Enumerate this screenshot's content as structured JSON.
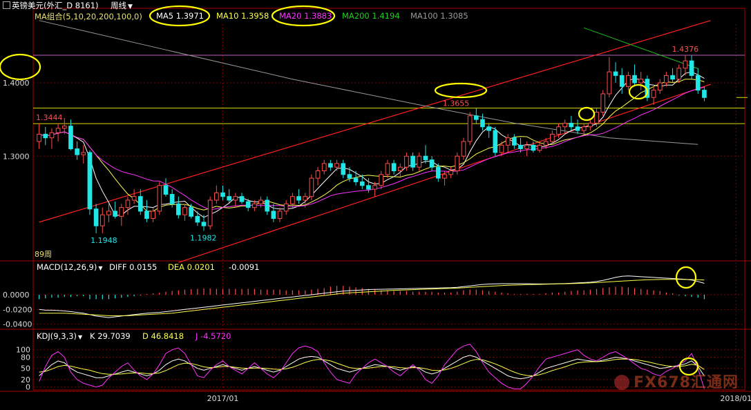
{
  "app": {
    "symbol_title": "英镑美元(外汇_D 8161)",
    "period_label": "周线",
    "period_icon": "chevron-down-icon",
    "watermark_text": "FX678汇通网"
  },
  "colors": {
    "background": "#000000",
    "up_candle": "#ff4d4d",
    "down_candle": "#20e6e6",
    "ma5": "#ffffff",
    "ma10": "#ffff4d",
    "ma20": "#ff33ff",
    "ma200": "#20c020",
    "ma100": "#9a9a9a",
    "channel": "#ff2020",
    "level_lines": "#e0e000",
    "highlight_ellipse": "#ffff00",
    "grid": "#800000"
  },
  "main_header": {
    "ma_group": "MA组合(5,10,20,200,100,0)",
    "ma5": "MA5 1.3971",
    "ma10": "MA10 1.3958",
    "ma20": "MA20 1.3883",
    "ma200": "MA200 1.4194",
    "ma100": "MA100 1.3085"
  },
  "macd_header": {
    "name": "MACD(12,26,9)",
    "diff": "DIFF 0.0155",
    "dea": "DEA 0.0201",
    "macd": "-0.0091"
  },
  "kdj_header": {
    "name": "KDJ(9,3,3)",
    "k": "K 29.7039",
    "d": "D 46.8418",
    "j": "J -4.5720"
  },
  "price_axis": {
    "ticks": [
      {
        "value": 1.4,
        "label": "1.4000"
      },
      {
        "value": 1.3,
        "label": "1.3000"
      }
    ]
  },
  "macd_axis": {
    "ticks": [
      {
        "value": 0.0,
        "label": "0.0000"
      },
      {
        "value": -0.02,
        "label": "-0.0200"
      },
      {
        "value": -0.04,
        "label": "-0.0400"
      }
    ]
  },
  "kdj_axis": {
    "ticks": [
      {
        "value": 100,
        "label": "100"
      },
      {
        "value": 80,
        "label": "80"
      },
      {
        "value": 50,
        "label": "50"
      },
      {
        "value": 20,
        "label": "20"
      },
      {
        "value": 0,
        "label": "0"
      }
    ]
  },
  "time_axis": {
    "labels": [
      {
        "bar": 29,
        "label": "2017/01"
      },
      {
        "bar": 110,
        "label": "2018/01"
      }
    ]
  },
  "annotations": {
    "high_label": "1.4376",
    "mid_high_label": "1.3655",
    "level_label": "1.3444",
    "low1_label": "1.1948",
    "low2_label": "1.1982",
    "weeks_label": "89周"
  },
  "chart_data": {
    "type": "candlestick",
    "instrument": "英镑美元(外汇_D 8161)",
    "period": "周线",
    "ylim": [
      1.16,
      1.48
    ],
    "ohlc": [
      [
        1.32,
        1.345,
        1.31,
        1.33
      ],
      [
        1.33,
        1.34,
        1.315,
        1.325
      ],
      [
        1.325,
        1.338,
        1.31,
        1.332
      ],
      [
        1.332,
        1.345,
        1.32,
        1.338
      ],
      [
        1.338,
        1.352,
        1.33,
        1.341
      ],
      [
        1.341,
        1.35,
        1.308,
        1.31
      ],
      [
        1.31,
        1.32,
        1.295,
        1.302
      ],
      [
        1.302,
        1.315,
        1.29,
        1.305
      ],
      [
        1.305,
        1.308,
        1.22,
        1.228
      ],
      [
        1.228,
        1.235,
        1.1948,
        1.205
      ],
      [
        1.205,
        1.23,
        1.195,
        1.22
      ],
      [
        1.22,
        1.235,
        1.21,
        1.225
      ],
      [
        1.225,
        1.238,
        1.215,
        1.218
      ],
      [
        1.218,
        1.235,
        1.205,
        1.23
      ],
      [
        1.23,
        1.245,
        1.22,
        1.24
      ],
      [
        1.24,
        1.255,
        1.235,
        1.245
      ],
      [
        1.245,
        1.255,
        1.22,
        1.225
      ],
      [
        1.225,
        1.24,
        1.21,
        1.215
      ],
      [
        1.215,
        1.23,
        1.21,
        1.225
      ],
      [
        1.225,
        1.265,
        1.22,
        1.26
      ],
      [
        1.26,
        1.27,
        1.245,
        1.248
      ],
      [
        1.248,
        1.255,
        1.23,
        1.235
      ],
      [
        1.235,
        1.245,
        1.215,
        1.22
      ],
      [
        1.22,
        1.235,
        1.212,
        1.23
      ],
      [
        1.23,
        1.235,
        1.215,
        1.218
      ],
      [
        1.218,
        1.225,
        1.205,
        1.21
      ],
      [
        1.21,
        1.22,
        1.1982,
        1.205
      ],
      [
        1.205,
        1.245,
        1.2,
        1.24
      ],
      [
        1.24,
        1.26,
        1.235,
        1.25
      ],
      [
        1.25,
        1.26,
        1.24,
        1.245
      ],
      [
        1.245,
        1.255,
        1.235,
        1.24
      ],
      [
        1.24,
        1.25,
        1.23,
        1.245
      ],
      [
        1.245,
        1.25,
        1.235,
        1.238
      ],
      [
        1.238,
        1.242,
        1.225,
        1.23
      ],
      [
        1.23,
        1.24,
        1.225,
        1.235
      ],
      [
        1.235,
        1.245,
        1.23,
        1.24
      ],
      [
        1.24,
        1.245,
        1.22,
        1.225
      ],
      [
        1.225,
        1.235,
        1.21,
        1.215
      ],
      [
        1.215,
        1.23,
        1.21,
        1.225
      ],
      [
        1.225,
        1.24,
        1.22,
        1.235
      ],
      [
        1.235,
        1.25,
        1.23,
        1.245
      ],
      [
        1.245,
        1.255,
        1.235,
        1.24
      ],
      [
        1.24,
        1.25,
        1.23,
        1.245
      ],
      [
        1.245,
        1.275,
        1.24,
        1.27
      ],
      [
        1.27,
        1.285,
        1.26,
        1.28
      ],
      [
        1.28,
        1.295,
        1.275,
        1.29
      ],
      [
        1.29,
        1.295,
        1.28,
        1.285
      ],
      [
        1.285,
        1.295,
        1.28,
        1.29
      ],
      [
        1.29,
        1.295,
        1.27,
        1.275
      ],
      [
        1.275,
        1.285,
        1.265,
        1.27
      ],
      [
        1.27,
        1.28,
        1.26,
        1.265
      ],
      [
        1.265,
        1.275,
        1.255,
        1.26
      ],
      [
        1.26,
        1.27,
        1.25,
        1.255
      ],
      [
        1.255,
        1.265,
        1.245,
        1.26
      ],
      [
        1.26,
        1.28,
        1.255,
        1.275
      ],
      [
        1.275,
        1.295,
        1.27,
        1.29
      ],
      [
        1.29,
        1.295,
        1.275,
        1.28
      ],
      [
        1.28,
        1.29,
        1.27,
        1.285
      ],
      [
        1.285,
        1.305,
        1.28,
        1.3
      ],
      [
        1.3,
        1.305,
        1.28,
        1.285
      ],
      [
        1.285,
        1.305,
        1.28,
        1.3
      ],
      [
        1.3,
        1.315,
        1.29,
        1.295
      ],
      [
        1.295,
        1.3,
        1.28,
        1.285
      ],
      [
        1.285,
        1.29,
        1.265,
        1.27
      ],
      [
        1.27,
        1.28,
        1.26,
        1.275
      ],
      [
        1.275,
        1.285,
        1.27,
        1.28
      ],
      [
        1.28,
        1.305,
        1.275,
        1.3
      ],
      [
        1.3,
        1.325,
        1.295,
        1.32
      ],
      [
        1.32,
        1.36,
        1.315,
        1.355
      ],
      [
        1.355,
        1.3655,
        1.345,
        1.35
      ],
      [
        1.35,
        1.358,
        1.335,
        1.34
      ],
      [
        1.34,
        1.345,
        1.325,
        1.335
      ],
      [
        1.335,
        1.34,
        1.3,
        1.305
      ],
      [
        1.305,
        1.32,
        1.3,
        1.315
      ],
      [
        1.315,
        1.33,
        1.305,
        1.325
      ],
      [
        1.325,
        1.33,
        1.31,
        1.315
      ],
      [
        1.315,
        1.325,
        1.305,
        1.31
      ],
      [
        1.31,
        1.32,
        1.3,
        1.315
      ],
      [
        1.315,
        1.32,
        1.305,
        1.308
      ],
      [
        1.308,
        1.32,
        1.305,
        1.315
      ],
      [
        1.315,
        1.325,
        1.31,
        1.32
      ],
      [
        1.32,
        1.335,
        1.315,
        1.33
      ],
      [
        1.33,
        1.345,
        1.325,
        1.34
      ],
      [
        1.34,
        1.35,
        1.33,
        1.345
      ],
      [
        1.345,
        1.355,
        1.335,
        1.34
      ],
      [
        1.34,
        1.35,
        1.33,
        1.335
      ],
      [
        1.335,
        1.345,
        1.33,
        1.34
      ],
      [
        1.34,
        1.35,
        1.335,
        1.345
      ],
      [
        1.345,
        1.365,
        1.34,
        1.36
      ],
      [
        1.36,
        1.39,
        1.355,
        1.385
      ],
      [
        1.385,
        1.435,
        1.38,
        1.415
      ],
      [
        1.415,
        1.428,
        1.4,
        1.41
      ],
      [
        1.41,
        1.42,
        1.385,
        1.395
      ],
      [
        1.395,
        1.415,
        1.39,
        1.41
      ],
      [
        1.41,
        1.425,
        1.395,
        1.4
      ],
      [
        1.4,
        1.415,
        1.39,
        1.405
      ],
      [
        1.405,
        1.41,
        1.375,
        1.38
      ],
      [
        1.38,
        1.395,
        1.37,
        1.39
      ],
      [
        1.39,
        1.405,
        1.385,
        1.4
      ],
      [
        1.4,
        1.415,
        1.395,
        1.41
      ],
      [
        1.41,
        1.42,
        1.4,
        1.405
      ],
      [
        1.405,
        1.425,
        1.4,
        1.42
      ],
      [
        1.42,
        1.4376,
        1.41,
        1.43
      ],
      [
        1.43,
        1.4376,
        1.405,
        1.41
      ],
      [
        1.41,
        1.42,
        1.385,
        1.39
      ],
      [
        1.39,
        1.395,
        1.375,
        1.38
      ]
    ],
    "ma5_label": "MA5 1.3971",
    "ma10_label": "MA10 1.3958",
    "ma20_label": "MA20 1.3883",
    "ma200_label": "MA200 1.4194",
    "ma100_label": "MA100 1.3085",
    "ma100_line": [
      [
        0,
        1.485
      ],
      [
        20,
        1.445
      ],
      [
        40,
        1.405
      ],
      [
        60,
        1.37
      ],
      [
        75,
        1.345
      ],
      [
        90,
        1.325
      ],
      [
        104,
        1.316
      ]
    ],
    "ma200_line": [
      [
        86,
        1.475
      ],
      [
        104,
        1.4194
      ]
    ],
    "channel_upper": [
      [
        0,
        1.21
      ],
      [
        106,
        1.485
      ]
    ],
    "channel_lower": [
      [
        22,
        1.155
      ],
      [
        106,
        1.398
      ]
    ],
    "horizontal_levels": [
      1.4376,
      1.3655,
      1.3444
    ],
    "macd": {
      "hist": [
        -0.006,
        -0.005,
        -0.004,
        -0.004,
        -0.003,
        -0.003,
        -0.002,
        -0.002,
        -0.006,
        -0.006,
        -0.006,
        -0.006,
        -0.005,
        -0.004,
        -0.003,
        -0.002,
        -0.001,
        0.001,
        0.002,
        0.003,
        0.004,
        0.005,
        0.006,
        0.007,
        0.0075,
        0.008,
        0.0085,
        0.0085,
        0.008,
        0.008,
        0.008,
        0.008,
        0.008,
        0.008,
        0.008,
        0.007,
        0.007,
        0.007,
        0.007,
        0.006,
        0.006,
        0.006,
        0.006,
        0.007,
        0.008,
        0.009,
        0.011,
        0.012,
        0.012,
        0.011,
        0.01,
        0.009,
        0.008,
        0.007,
        0.006,
        0.006,
        0.005,
        0.005,
        0.005,
        0.004,
        0.004,
        0.004,
        0.004,
        0.003,
        0.003,
        0.003,
        0.004,
        0.006,
        0.007,
        0.007,
        0.006,
        0.005,
        0.004,
        0.003,
        0.002,
        0.001,
        0.001,
        0.001,
        0.001,
        0.001,
        0.002,
        0.003,
        0.003,
        0.004,
        0.005,
        0.006,
        0.006,
        0.007,
        0.008,
        0.009,
        0.01,
        0.011,
        0.011,
        0.01,
        0.009,
        0.008,
        0.007,
        0.006,
        0.005,
        0.003,
        0.002,
        -0.001,
        -0.002,
        -0.003,
        -0.004,
        -0.006
      ],
      "diff": [
        -0.02,
        -0.021,
        -0.021,
        -0.0215,
        -0.022,
        -0.023,
        -0.024,
        -0.025,
        -0.027,
        -0.029,
        -0.03,
        -0.031,
        -0.03,
        -0.029,
        -0.028,
        -0.027,
        -0.026,
        -0.025,
        -0.0245,
        -0.024,
        -0.023,
        -0.022,
        -0.021,
        -0.02,
        -0.019,
        -0.018,
        -0.017,
        -0.016,
        -0.015,
        -0.014,
        -0.013,
        -0.012,
        -0.011,
        -0.01,
        -0.009,
        -0.008,
        -0.007,
        -0.006,
        -0.005,
        -0.004,
        -0.003,
        -0.002,
        -0.001,
        0.0,
        0.001,
        0.002,
        0.003,
        0.004,
        0.005,
        0.0055,
        0.006,
        0.0065,
        0.007,
        0.0072,
        0.0074,
        0.0076,
        0.0078,
        0.008,
        0.0082,
        0.0084,
        0.0086,
        0.0088,
        0.009,
        0.0092,
        0.0094,
        0.0096,
        0.01,
        0.011,
        0.012,
        0.013,
        0.014,
        0.0145,
        0.0148,
        0.015,
        0.015,
        0.015,
        0.015,
        0.015,
        0.0148,
        0.0146,
        0.0146,
        0.0148,
        0.015,
        0.0152,
        0.0156,
        0.016,
        0.0165,
        0.017,
        0.018,
        0.0195,
        0.0215,
        0.0235,
        0.025,
        0.0255,
        0.025,
        0.0245,
        0.024,
        0.0235,
        0.023,
        0.0225,
        0.022,
        0.0215,
        0.021,
        0.02,
        0.018,
        0.0155
      ],
      "dea": [
        -0.025,
        -0.025,
        -0.025,
        -0.025,
        -0.025,
        -0.0255,
        -0.026,
        -0.0265,
        -0.027,
        -0.0275,
        -0.028,
        -0.0285,
        -0.0285,
        -0.0285,
        -0.0285,
        -0.028,
        -0.0275,
        -0.027,
        -0.0265,
        -0.026,
        -0.0255,
        -0.025,
        -0.024,
        -0.023,
        -0.022,
        -0.021,
        -0.02,
        -0.019,
        -0.018,
        -0.017,
        -0.016,
        -0.015,
        -0.014,
        -0.013,
        -0.012,
        -0.011,
        -0.01,
        -0.009,
        -0.008,
        -0.007,
        -0.006,
        -0.005,
        -0.004,
        -0.003,
        -0.002,
        -0.001,
        0.0,
        0.001,
        0.002,
        0.0025,
        0.003,
        0.0035,
        0.004,
        0.0045,
        0.005,
        0.0055,
        0.006,
        0.0063,
        0.0066,
        0.0069,
        0.0072,
        0.0075,
        0.0078,
        0.0081,
        0.0084,
        0.0087,
        0.009,
        0.0095,
        0.01,
        0.0105,
        0.011,
        0.0115,
        0.012,
        0.0125,
        0.0128,
        0.0131,
        0.0134,
        0.0137,
        0.0139,
        0.0141,
        0.0143,
        0.0145,
        0.0147,
        0.0149,
        0.0151,
        0.0154,
        0.0157,
        0.016,
        0.0165,
        0.017,
        0.0175,
        0.018,
        0.0185,
        0.019,
        0.0195,
        0.02,
        0.0203,
        0.0205,
        0.0207,
        0.0208,
        0.0208,
        0.0208,
        0.0207,
        0.0206,
        0.0204,
        0.0201
      ]
    },
    "kdj": {
      "k": [
        30,
        45,
        60,
        70,
        65,
        50,
        40,
        35,
        30,
        25,
        25,
        30,
        35,
        40,
        45,
        40,
        35,
        30,
        35,
        45,
        60,
        70,
        75,
        70,
        60,
        50,
        45,
        50,
        55,
        60,
        55,
        50,
        45,
        50,
        55,
        50,
        45,
        40,
        45,
        55,
        65,
        75,
        80,
        82,
        80,
        70,
        60,
        50,
        45,
        40,
        45,
        50,
        55,
        60,
        58,
        55,
        50,
        45,
        50,
        55,
        50,
        40,
        35,
        40,
        50,
        60,
        70,
        80,
        85,
        80,
        70,
        60,
        50,
        40,
        30,
        25,
        22,
        25,
        30,
        40,
        50,
        55,
        60,
        65,
        70,
        75,
        72,
        70,
        68,
        72,
        76,
        80,
        78,
        75,
        70,
        65,
        60,
        55,
        50,
        52,
        55,
        58,
        62,
        70,
        55,
        30
      ],
      "d": [
        40,
        42,
        48,
        55,
        58,
        56,
        52,
        48,
        45,
        40,
        36,
        34,
        34,
        35,
        37,
        38,
        38,
        36,
        36,
        38,
        44,
        52,
        60,
        64,
        63,
        59,
        54,
        52,
        53,
        55,
        55,
        53,
        51,
        50,
        51,
        51,
        50,
        48,
        47,
        49,
        53,
        59,
        66,
        71,
        74,
        73,
        70,
        64,
        58,
        52,
        50,
        50,
        51,
        53,
        55,
        55,
        54,
        52,
        51,
        52,
        52,
        49,
        45,
        44,
        46,
        50,
        56,
        63,
        70,
        74,
        73,
        68,
        62,
        55,
        47,
        40,
        34,
        31,
        30,
        33,
        38,
        44,
        49,
        54,
        60,
        65,
        67,
        68,
        68,
        69,
        71,
        74,
        75,
        75,
        74,
        71,
        68,
        64,
        60,
        57,
        55,
        55,
        57,
        61,
        58,
        47
      ],
      "j": [
        15,
        55,
        85,
        95,
        80,
        40,
        20,
        10,
        5,
        0,
        5,
        25,
        40,
        55,
        65,
        45,
        30,
        20,
        35,
        60,
        90,
        100,
        105,
        90,
        60,
        30,
        25,
        45,
        60,
        70,
        55,
        45,
        35,
        50,
        65,
        50,
        35,
        25,
        40,
        65,
        90,
        105,
        110,
        105,
        95,
        65,
        40,
        20,
        15,
        10,
        35,
        50,
        65,
        75,
        65,
        55,
        40,
        30,
        45,
        60,
        45,
        20,
        10,
        30,
        60,
        80,
        100,
        110,
        115,
        95,
        65,
        40,
        25,
        10,
        0,
        -5,
        -5,
        10,
        30,
        55,
        75,
        80,
        85,
        90,
        95,
        100,
        85,
        75,
        70,
        80,
        90,
        95,
        85,
        75,
        62,
        50,
        45,
        35,
        30,
        42,
        50,
        60,
        70,
        90,
        50,
        -5
      ]
    }
  }
}
